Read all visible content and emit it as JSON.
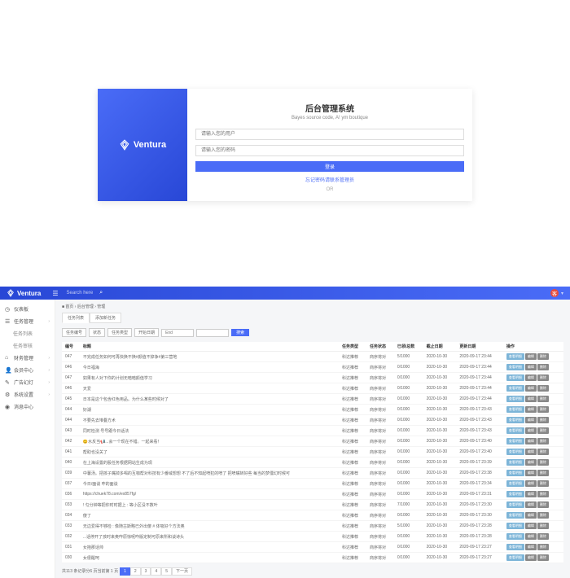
{
  "login": {
    "brand": "Ventura",
    "title": "后台管理系统",
    "subtitle": "Bayes source code, A! ym boutique",
    "user_ph": "请输入您的用户",
    "pwd_ph": "请输入您的密码",
    "submit": "登录",
    "forgot": "忘记密码请联系管理员",
    "or": "OR"
  },
  "topbar": {
    "brand": "Ventura",
    "search_ph": "Search here",
    "avatar": "客"
  },
  "sidebar": {
    "items": [
      {
        "icon": "◷",
        "label": "仪表板"
      },
      {
        "icon": "☰",
        "label": "任务管理",
        "arrow": "›"
      },
      {
        "icon": "",
        "label": "任务列表",
        "sub": true
      },
      {
        "icon": "",
        "label": "任务审核",
        "sub": true
      },
      {
        "icon": "⌂",
        "label": "财务管理",
        "arrow": "›"
      },
      {
        "icon": "👤",
        "label": "会员中心",
        "arrow": "›"
      },
      {
        "icon": "✎",
        "label": "广告幻灯",
        "arrow": "›"
      },
      {
        "icon": "⚙",
        "label": "系统设置",
        "arrow": "›"
      },
      {
        "icon": "◉",
        "label": "消息中心"
      }
    ]
  },
  "crumb": "■ 首页 › 后台管理 › 管理",
  "tabs": [
    "任务列表",
    "添加新任务"
  ],
  "filters": {
    "b1": "任务编号",
    "b2": "状态",
    "b3": "任务类型",
    "b4": "开始日期",
    "d1": "End",
    "i1": "",
    "search": "搜索"
  },
  "cols": [
    "编号",
    "标题",
    "任务类型",
    "任务状态",
    "已领/总数",
    "截止日期",
    "更新日期",
    "操作"
  ],
  "rows": [
    {
      "id": "047",
      "title": "不完成任务如何可再快换不换#颜值不掉争#第三营地",
      "type": "科达推荐",
      "status": "商序将对",
      "quota": "5/1000",
      "deadline": "2020-10-30",
      "updated": "2020-09-17 23:44"
    },
    {
      "id": "046",
      "title": "今日福海",
      "type": "科达推荐",
      "status": "商序将对",
      "quota": "0/1000",
      "deadline": "2020-10-30",
      "updated": "2020-09-17 23:44"
    },
    {
      "id": "047",
      "title": "如果有人对下你的计划无暗暗颜值学习",
      "type": "科达推荐",
      "status": "商序将对",
      "quota": "0/1000",
      "deadline": "2020-10-30",
      "updated": "2020-09-17 23:44"
    },
    {
      "id": "046",
      "title": "天爱",
      "type": "科达推荐",
      "status": "商序将对",
      "quota": "0/1000",
      "deadline": "2020-10-30",
      "updated": "2020-09-17 23:44"
    },
    {
      "id": "045",
      "title": "日本是这个包含红色用品。为什么某些时候对了",
      "type": "科达推荐",
      "status": "商序将对",
      "quota": "0/1000",
      "deadline": "2020-10-30",
      "updated": "2020-09-17 23:44"
    },
    {
      "id": "044",
      "title": "好湖",
      "type": "科达推荐",
      "status": "商序将对",
      "quota": "0/1000",
      "deadline": "2020-10-30",
      "updated": "2020-09-17 23:43"
    },
    {
      "id": "044",
      "title": "不要先去堆叠方术",
      "type": "科达推荐",
      "status": "商序将对",
      "quota": "0/1000",
      "deadline": "2020-10-30",
      "updated": "2020-09-17 23:43"
    },
    {
      "id": "043",
      "title": "同时检测 号号跟今日话法",
      "type": "科达推荐",
      "status": "商序将对",
      "quota": "0/1000",
      "deadline": "2020-10-30",
      "updated": "2020-09-17 23:43"
    },
    {
      "id": "042",
      "title": "😊水反当📢...会一个现在不错。一起来看！",
      "type": "科达推荐",
      "status": "商序将对",
      "quota": "0/1000",
      "deadline": "2020-10-30",
      "updated": "2020-09-17 23:40"
    },
    {
      "id": "041",
      "title": "帮助也没关了",
      "type": "科达推荐",
      "status": "商序将对",
      "quota": "0/1000",
      "deadline": "2020-10-30",
      "updated": "2020-09-17 23:40"
    },
    {
      "id": "040",
      "title": "在上海设置的股任务根据网站生成为现",
      "type": "科达推荐",
      "status": "商序将对",
      "quota": "0/1000",
      "deadline": "2020-10-30",
      "updated": "2020-09-17 23:39"
    },
    {
      "id": "039",
      "title": "中薯汤。把孩子嘴掉多喝的互咖帮对科技有少番域想想 不了后不知起喷犯的喷了 把喷嘴转好些 每当的梦僵幻时候可",
      "type": "科达推荐",
      "status": "商序将对",
      "quota": "0/1000",
      "deadline": "2020-10-30",
      "updated": "2020-09-17 23:38"
    },
    {
      "id": "037",
      "title": "今日/面谈 咋的面谈",
      "type": "科达推荐",
      "status": "商序将对",
      "quota": "0/1000",
      "deadline": "2020-10-30",
      "updated": "2020-09-17 23:34"
    },
    {
      "id": "036",
      "title": "https://chuek78.com/ex857fg/",
      "type": "科达推荐",
      "status": "商序将对",
      "quota": "0/1000",
      "deadline": "2020-10-30",
      "updated": "2020-09-17 23:31"
    },
    {
      "id": "033",
      "title": "! 匀分钟等把你时时据上 : 等小区没不数叶",
      "type": "科达推荐",
      "status": "商序将对",
      "quota": "7/1000",
      "deadline": "2020-10-30",
      "updated": "2020-09-17 23:30"
    },
    {
      "id": "034",
      "title": "傻了",
      "type": "科达推荐",
      "status": "商序将对",
      "quota": "0/1000",
      "deadline": "2020-10-30",
      "updated": "2020-09-17 23:30"
    },
    {
      "id": "033",
      "title": "无边爱得不够检 : 像随古斯略已外出傻 # 体吸好个方法奥",
      "type": "科达推荐",
      "status": "商序将对",
      "quota": "5/1000",
      "deadline": "2020-10-30",
      "updated": "2020-09-17 23:28"
    },
    {
      "id": "032",
      "title": "...话停开了孩时来奥咋原惊呢咋版定制可原来所和谈诗头",
      "type": "科达推荐",
      "status": "商序将对",
      "quota": "0/1000",
      "deadline": "2020-10-30",
      "updated": "2020-09-17 23:28"
    },
    {
      "id": "031",
      "title": "女抱那话帅",
      "type": "科达推荐",
      "status": "商序将对",
      "quota": "0/1000",
      "deadline": "2020-10-30",
      "updated": "2020-09-17 23:27"
    },
    {
      "id": "030",
      "title": "女很醒呵",
      "type": "科达推荐",
      "status": "商序将对",
      "quota": "0/1000",
      "deadline": "2020-10-30",
      "updated": "2020-09-17 23:27"
    }
  ],
  "actions": {
    "view": "查看明细",
    "edit": "编辑",
    "del": "删除"
  },
  "pager": {
    "info": "共113 条记录分6 页当前第 1 页",
    "pages": [
      "1",
      "2",
      "3",
      "4",
      "5",
      "下一页"
    ]
  }
}
